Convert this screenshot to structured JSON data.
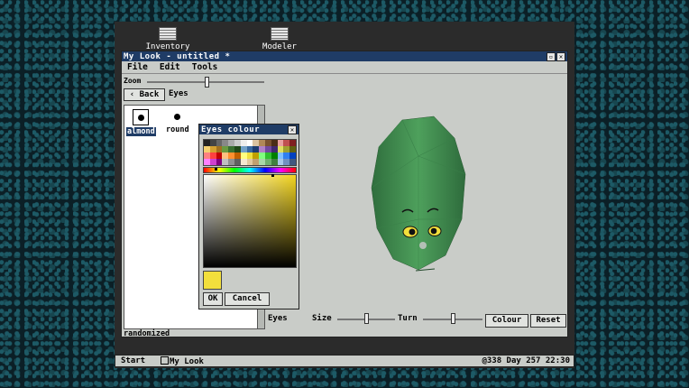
{
  "desktop": {
    "icons": [
      {
        "label": "Inventory",
        "icon": "document-icon"
      },
      {
        "label": "Modeler",
        "icon": "document-icon"
      }
    ]
  },
  "window": {
    "title": "My Look - untitled *",
    "controls": [
      "minimize-icon",
      "close-icon"
    ],
    "menu": [
      "File",
      "Edit",
      "Tools"
    ],
    "zoom_label": "Zoom",
    "back_label": "Back",
    "breadcrumb": "Eyes",
    "zoom_level": 0.72
  },
  "list": {
    "items": [
      {
        "label": "almond",
        "selected": true
      },
      {
        "label": "round",
        "selected": false
      }
    ]
  },
  "bottom": {
    "category_label": "Eyes",
    "status": "randomized",
    "size_label": "Size",
    "turn_label": "Turn",
    "size_value": 0.5,
    "turn_value": 0.5,
    "colour_button": "Colour",
    "reset_button": "Reset"
  },
  "dialog": {
    "title": "Eyes colour",
    "ok_label": "OK",
    "cancel_label": "Cancel",
    "selected_colour": "#f2df3c",
    "palette": [
      "#222",
      "#444",
      "#666",
      "#888",
      "#aaa",
      "#ccc",
      "#eee",
      "#fff",
      "#d9c2a1",
      "#b08858",
      "#7a5230",
      "#4a2d16",
      "#e8a0a0",
      "#c05050",
      "#802020",
      "#f4d070",
      "#d4a030",
      "#a07020",
      "#6a9a40",
      "#3a7030",
      "#204818",
      "#70a0c8",
      "#3868a0",
      "#1c3c70",
      "#b080c8",
      "#7048a0",
      "#402870",
      "#e0e060",
      "#a0a030",
      "#606010",
      "#ff8080",
      "#ff4040",
      "#c00000",
      "#ffc080",
      "#ff9030",
      "#c06000",
      "#ffff80",
      "#f0e040",
      "#c0a000",
      "#80ff80",
      "#30c030",
      "#008000",
      "#80c0ff",
      "#3080f0",
      "#0040c0",
      "#ff80ff",
      "#d040d0",
      "#800080",
      "#c0c0c0",
      "#909090",
      "#606060",
      "#f4e8d0",
      "#e0c8a0",
      "#c0a070",
      "#a8d8a8",
      "#70b070",
      "#408040",
      "#a8c8e8",
      "#7090c0",
      "#405880"
    ]
  },
  "taskbar": {
    "start_label": "Start",
    "task_label": "My Look",
    "clock": "@338 Day 257   22:30"
  },
  "colors": {
    "titlebar": "#1f3c66",
    "window_bg": "#c9ccc8",
    "face_green": "#4c9d5b",
    "eye_yellow": "#f2df3c"
  }
}
